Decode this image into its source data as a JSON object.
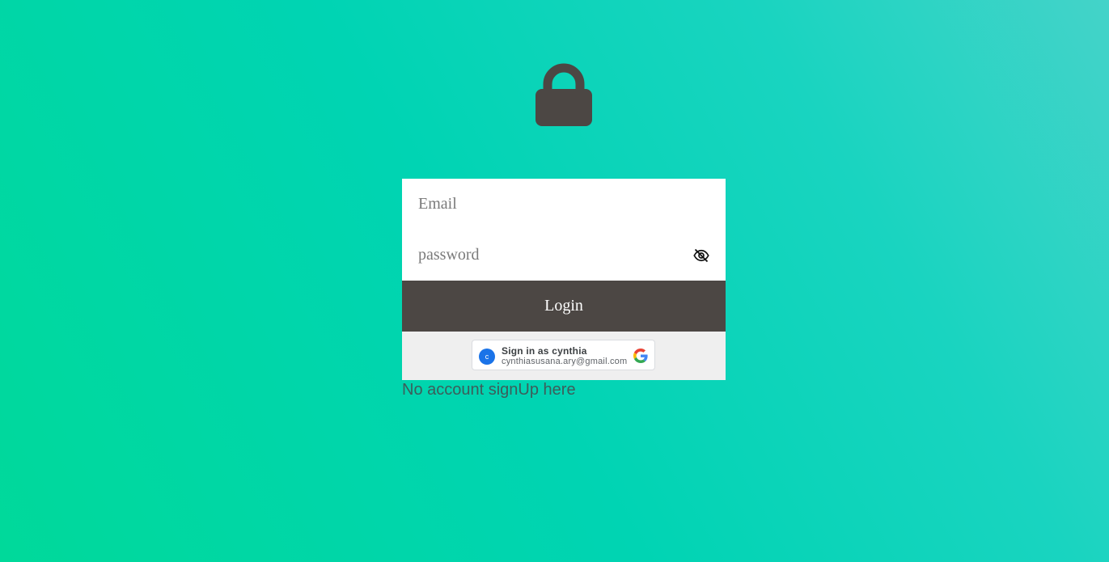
{
  "header": {
    "icon": "lock-icon"
  },
  "login_form": {
    "email": {
      "placeholder": "Email",
      "value": ""
    },
    "password": {
      "placeholder": "password",
      "value": "",
      "toggle_icon": "eye-off-icon"
    },
    "login_label": "Login"
  },
  "google_signin": {
    "avatar_letter": "c",
    "title": "Sign in as cynthia",
    "email": "cynthiasusana.ary@gmail.com",
    "icon": "google-logo-icon"
  },
  "signup_link": "No account signUp here",
  "colors": {
    "accent": "#00d4b3",
    "button": "#4c4744",
    "avatar": "#1a73e8"
  }
}
